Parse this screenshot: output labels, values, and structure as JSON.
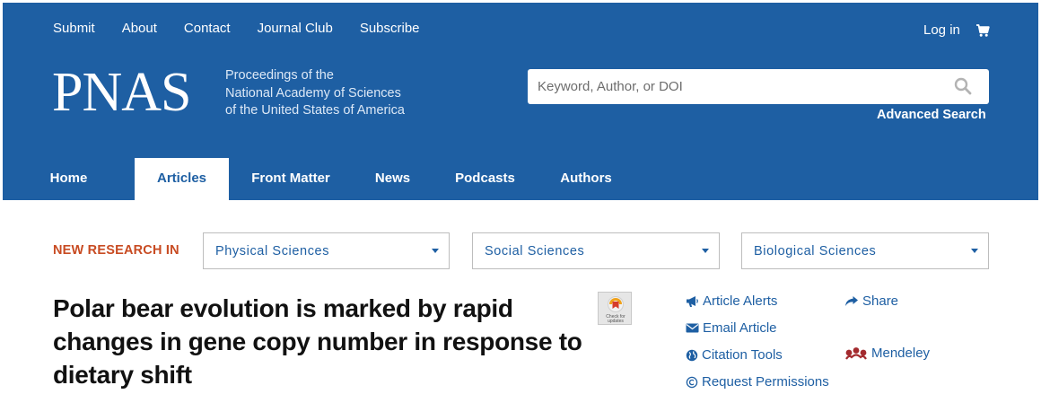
{
  "topnav": {
    "items": [
      "Submit",
      "About",
      "Contact",
      "Journal Club",
      "Subscribe"
    ],
    "login": "Log in",
    "cart_icon": "cart-icon"
  },
  "brand": {
    "logo": "PNAS",
    "tagline": [
      "Proceedings of the",
      "National Academy of Sciences",
      "of the United States of America"
    ]
  },
  "search": {
    "placeholder": "Keyword, Author, or DOI",
    "value": "",
    "icon": "search-icon",
    "advanced": "Advanced Search"
  },
  "mainnav": {
    "tabs": [
      "Home",
      "Articles",
      "Front Matter",
      "News",
      "Podcasts",
      "Authors"
    ],
    "active": "Articles"
  },
  "new_research": {
    "label": "NEW RESEARCH IN",
    "dropdowns": [
      "Physical Sciences",
      "Social Sciences",
      "Biological Sciences"
    ]
  },
  "article": {
    "title_lines": [
      "Polar bear evolution is marked by rapid",
      "changes in gene copy number in response to",
      "dietary shift"
    ],
    "badge_text": [
      "Check for",
      "updates"
    ]
  },
  "tools": {
    "article_alerts": "Article Alerts",
    "email_article": "Email Article",
    "citation_tools": "Citation Tools",
    "request_permissions": "Request Permissions",
    "share": "Share",
    "mendeley": "Mendeley"
  },
  "colors": {
    "header_bg": "#1e5fa3",
    "accent_orange": "#c84b22",
    "link_blue": "#1e5fa3"
  }
}
